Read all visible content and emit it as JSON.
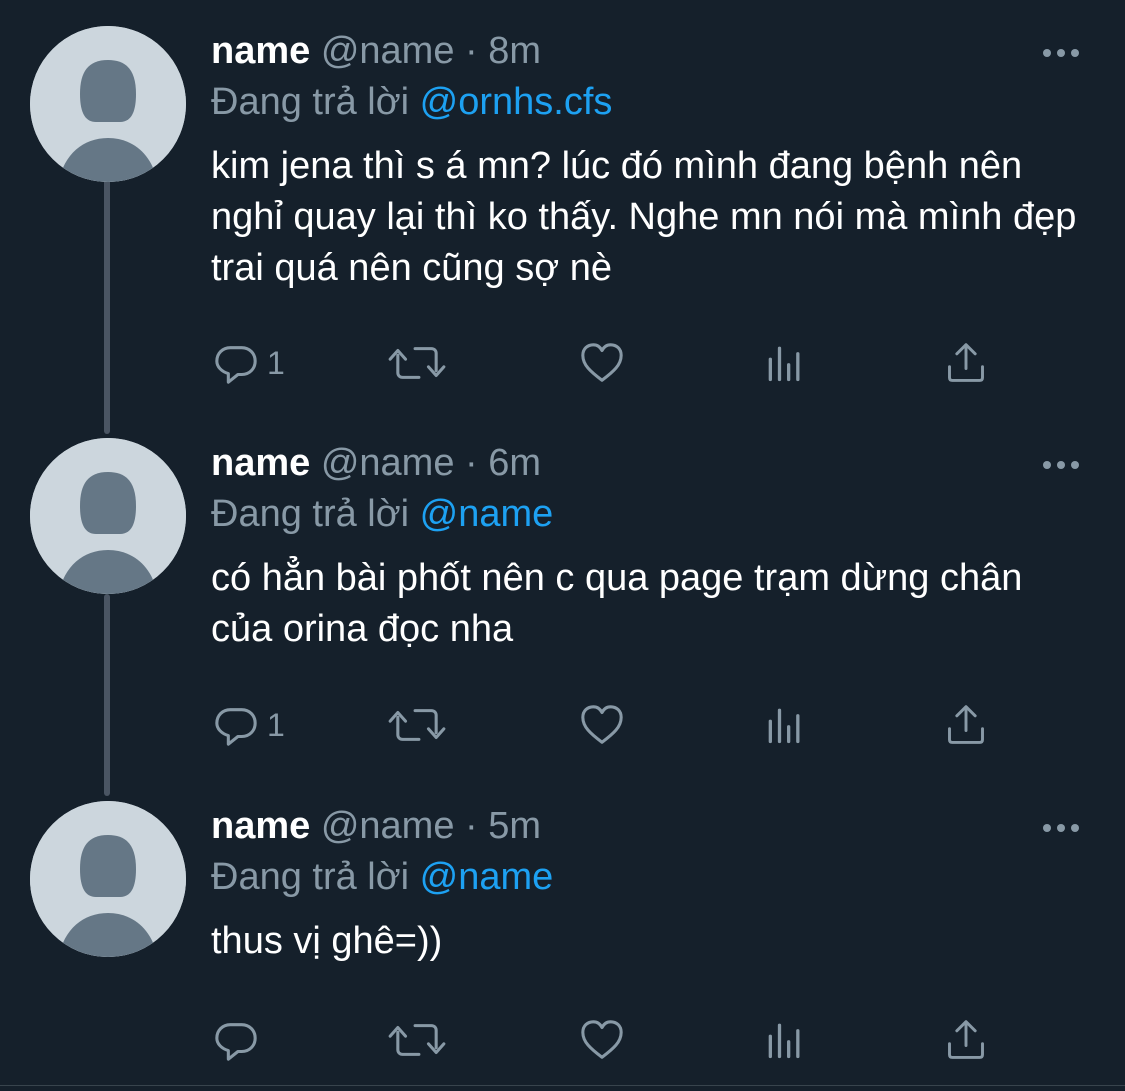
{
  "tweets": [
    {
      "name": "name",
      "handle": "@name",
      "time": "8m",
      "reply_prefix": "Đang trả lời",
      "reply_to": "@ornhs.cfs",
      "text": "kim jena thì s á mn? lúc đó mình đang bệnh nên nghỉ quay lại thì ko thấy. Nghe mn nói mà mình đẹp trai quá nên cũng sợ nè",
      "reply_count": "1"
    },
    {
      "name": "name",
      "handle": "@name",
      "time": "6m",
      "reply_prefix": "Đang trả lời",
      "reply_to": "@name",
      "text": "có hẳn bài phốt nên c qua page trạm dừng chân của orina đọc nha",
      "reply_count": "1"
    },
    {
      "name": "name",
      "handle": "@name",
      "time": "5m",
      "reply_prefix": "Đang trả lời",
      "reply_to": "@name",
      "text": "thus vị ghê=))",
      "reply_count": ""
    }
  ],
  "meta_separator": "·",
  "icons": {
    "reply": "reply-icon",
    "retweet": "retweet-icon",
    "like": "heart-icon",
    "analytics": "analytics-icon",
    "share": "share-icon",
    "more": "more-icon"
  },
  "colors": {
    "background": "#15202b",
    "secondary_text": "#8899a6",
    "accent": "#1da1f2",
    "avatar_bg": "#ccd6dd",
    "avatar_figure": "#657786"
  }
}
